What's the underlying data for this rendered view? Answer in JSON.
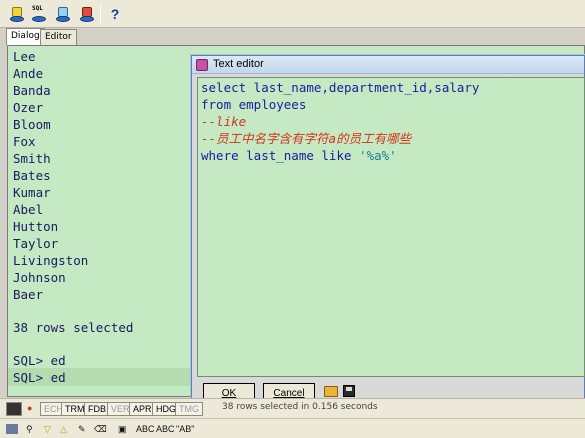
{
  "toolbar": {
    "icons": [
      "db-connect-icon",
      "db-sql-icon",
      "db-disconnect-icon",
      "db-refresh-icon"
    ],
    "sql_tag": "SQL",
    "help_label": "?"
  },
  "tabs": [
    {
      "label": "Dialog",
      "active": true
    },
    {
      "label": "Editor",
      "active": false
    }
  ],
  "output": {
    "lines": [
      "Lee",
      "Ande",
      "Banda",
      "Ozer",
      "Bloom",
      "Fox",
      "Smith",
      "Bates",
      "Kumar",
      "Abel",
      "Hutton",
      "Taylor",
      "Livingston",
      "Johnson",
      "Baer"
    ],
    "rows_selected": "38 rows selected",
    "prompt1": "SQL> ed",
    "prompt2": "SQL> ed"
  },
  "editor": {
    "title": "Text editor",
    "code": {
      "l1": "select last_name,department_id,salary",
      "l2": "from employees",
      "l3": "--like",
      "l4": "--员工中名字含有字符a的员工有哪些",
      "l5_kw": "where last_name like ",
      "l5_str": "'%a%'"
    },
    "ok_label": "OK",
    "cancel_label": "Cancel"
  },
  "statusbar": {
    "buttons": [
      "ECH",
      "TRM",
      "FDB",
      "VER",
      "APR",
      "HDG",
      "TMG"
    ],
    "message": "38 rows selected in 0.156 seconds"
  },
  "bottom_toolbar": {
    "abc1": "ABC",
    "abc2": "ABC",
    "ab_quoted": "\"AB\""
  },
  "colors": {
    "pane_bg": "#c5e9c2",
    "comment": "#d4321b",
    "keyword": "#1b1b9e",
    "string": "#1b7a9e"
  }
}
